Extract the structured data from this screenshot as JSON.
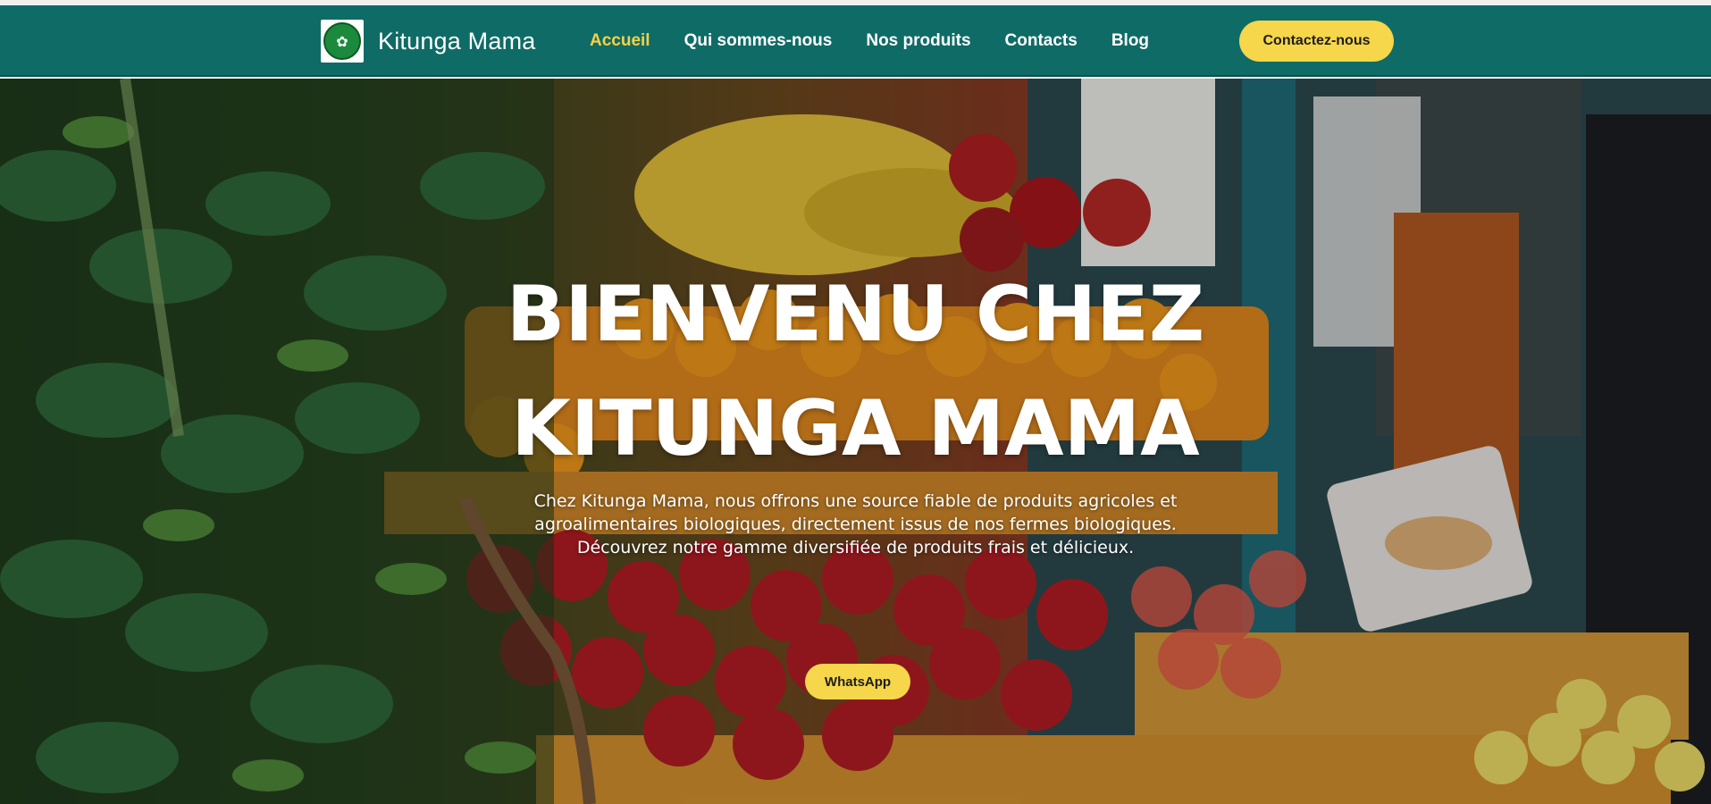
{
  "header": {
    "brand_name": "Kitunga Mama",
    "logo_icon": "kitunga-mama-logo",
    "nav": [
      {
        "label": "Accueil",
        "active": true
      },
      {
        "label": "Qui sommes-nous",
        "active": false
      },
      {
        "label": "Nos produits",
        "active": false
      },
      {
        "label": "Contacts",
        "active": false
      },
      {
        "label": "Blog",
        "active": false
      }
    ],
    "cta_label": "Contactez-nous"
  },
  "hero": {
    "title_line1": "BIENVENU CHEZ",
    "title_line2": "KITUNGA MAMA",
    "description": "Chez Kitunga Mama, nous offrons une source fiable de produits agricoles et agroalimentaires biologiques, directement issus de nos fermes biologiques. Découvrez notre gamme diversifiée de produits frais et délicieux.",
    "whatsapp_label": "WhatsApp",
    "background_image": "fruit-market-stall-photo"
  },
  "colors": {
    "header_bg": "#0f6b66",
    "accent_yellow": "#f6d64a",
    "active_link": "#f7d046",
    "text_white": "#ffffff"
  }
}
